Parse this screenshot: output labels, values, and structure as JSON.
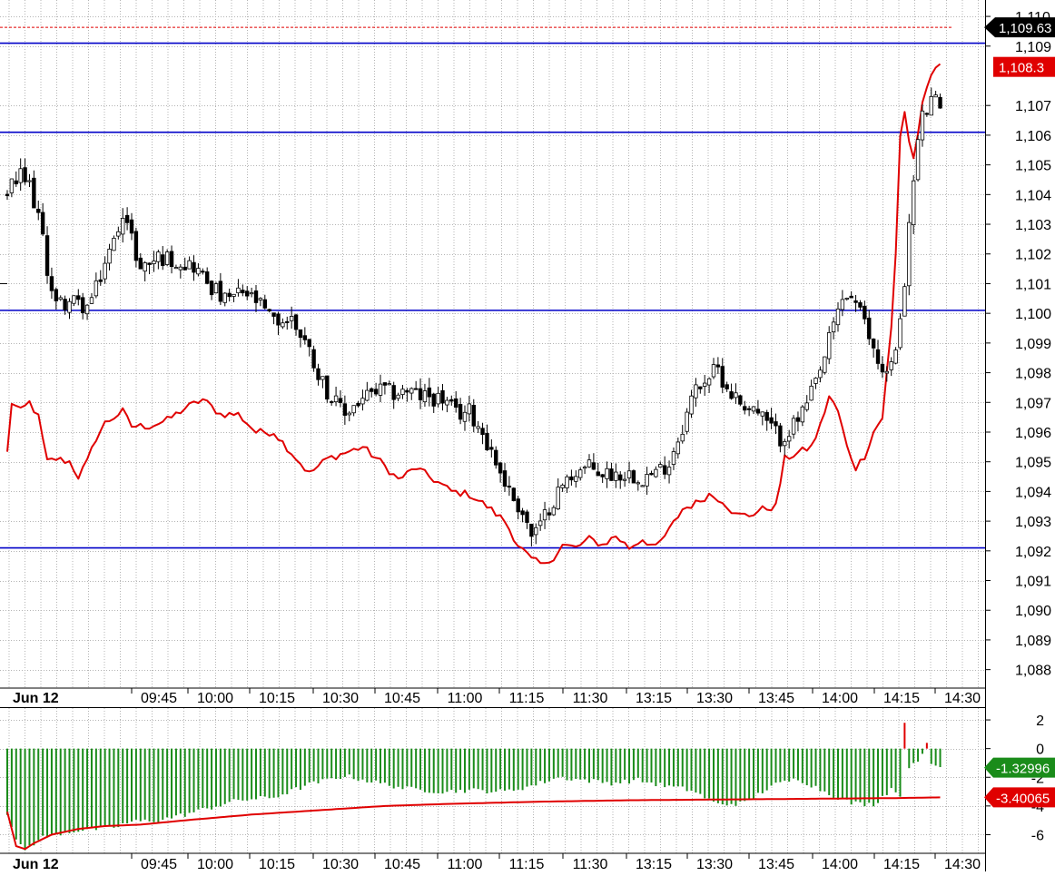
{
  "colors": {
    "background": "#ffffff",
    "grid": "#b4b4b4",
    "hline": "#0000c8",
    "price_line": "#e00000",
    "candle_up": "#ffffff",
    "candle_down": "#000000",
    "histogram": "#1a8c1a",
    "histogram_pos": "#e00000",
    "signal_line": "#e00000",
    "axis_text": "#000000",
    "tag_black": "#000000",
    "tag_red": "#e00000",
    "tag_green": "#1a8c1a"
  },
  "time_axis": {
    "date_label": "Jun 12",
    "labels": [
      "09:45",
      "10:00",
      "10:15",
      "10:30",
      "10:45",
      "11:00",
      "11:15",
      "11:30",
      "13:15",
      "13:30",
      "13:45",
      "14:00",
      "14:15",
      "14:30"
    ]
  },
  "main_chart": {
    "type": "candlestick",
    "grid": true,
    "ylim": [
      1.0875,
      1.1104
    ],
    "y_ticks": [
      "1,110",
      "1,109",
      "1,107",
      "1,106",
      "1,105",
      "1,104",
      "1,103",
      "1,102",
      "1,101",
      "1,100",
      "1,099",
      "1,098",
      "1,097",
      "1,096",
      "1,095",
      "1,094",
      "1,093",
      "1,092",
      "1,091",
      "1,090",
      "1,089",
      "1,088"
    ],
    "y_tick_values": [
      1.11,
      1.109,
      1.107,
      1.106,
      1.105,
      1.104,
      1.103,
      1.102,
      1.101,
      1.1,
      1.099,
      1.098,
      1.097,
      1.096,
      1.095,
      1.094,
      1.093,
      1.092,
      1.091,
      1.09,
      1.089,
      1.088
    ],
    "horizontal_lines": [
      1.1091,
      1.1061,
      1.1001,
      1.0921
    ],
    "dashed_line": 1.10963,
    "price_tags": [
      {
        "label": "1,109.63",
        "value": 1.10963,
        "style": "black"
      },
      {
        "label": "1,108.3",
        "value": 1.1083,
        "style": "red"
      }
    ],
    "candle_anchors": [
      [
        0,
        1.1041
      ],
      [
        3,
        1.1046
      ],
      [
        5,
        1.1043
      ],
      [
        7,
        1.1033
      ],
      [
        9,
        1.1015
      ],
      [
        11,
        1.1003
      ],
      [
        14,
        1.1004
      ],
      [
        18,
        1.1002
      ],
      [
        20,
        1.1008
      ],
      [
        22,
        1.1017
      ],
      [
        24,
        1.1024
      ],
      [
        26,
        1.1035
      ],
      [
        28,
        1.1025
      ],
      [
        30,
        1.1015
      ],
      [
        34,
        1.1019
      ],
      [
        38,
        1.1018
      ],
      [
        42,
        1.1016
      ],
      [
        46,
        1.1009
      ],
      [
        49,
        1.1004
      ],
      [
        53,
        1.1007
      ],
      [
        56,
        1.1004
      ],
      [
        60,
        1.0997
      ],
      [
        64,
        1.0998
      ],
      [
        67,
        1.0991
      ],
      [
        70,
        1.098
      ],
      [
        73,
        1.0971
      ],
      [
        76,
        1.0966
      ],
      [
        78,
        1.0969
      ],
      [
        81,
        1.0972
      ],
      [
        84,
        1.0974
      ],
      [
        87,
        1.0973
      ],
      [
        90,
        1.0974
      ],
      [
        93,
        1.0972
      ],
      [
        95,
        1.0972
      ],
      [
        98,
        1.0971
      ],
      [
        101,
        1.0966
      ],
      [
        104,
        1.0967
      ],
      [
        107,
        1.096
      ],
      [
        110,
        1.095
      ],
      [
        113,
        1.094
      ],
      [
        116,
        1.0933
      ],
      [
        118,
        1.0925
      ],
      [
        120,
        1.0928
      ],
      [
        122,
        1.0935
      ],
      [
        125,
        1.0942
      ],
      [
        128,
        1.0947
      ],
      [
        131,
        1.0948
      ],
      [
        134,
        1.0946
      ],
      [
        137,
        1.0946
      ],
      [
        140,
        1.0946
      ],
      [
        143,
        1.0945
      ],
      [
        146,
        1.0946
      ],
      [
        149,
        1.095
      ],
      [
        152,
        1.0962
      ],
      [
        155,
        1.0975
      ],
      [
        158,
        1.0979
      ],
      [
        160,
        1.0981
      ],
      [
        162,
        1.0975
      ],
      [
        165,
        1.097
      ],
      [
        168,
        1.0968
      ],
      [
        171,
        1.0963
      ],
      [
        174,
        1.0958
      ],
      [
        177,
        1.0962
      ],
      [
        180,
        1.0969
      ],
      [
        183,
        1.098
      ],
      [
        186,
        1.0996
      ],
      [
        188,
        1.1005
      ],
      [
        190,
        1.1006
      ],
      [
        192,
        1.1
      ],
      [
        194,
        1.0992
      ],
      [
        196,
        1.0984
      ],
      [
        198,
        1.098
      ],
      [
        200,
        1.0986
      ],
      [
        202,
        1.1012
      ],
      [
        204,
        1.1045
      ],
      [
        205,
        1.1058
      ],
      [
        206,
        1.1066
      ],
      [
        208,
        1.1071
      ],
      [
        209,
        1.1071
      ],
      [
        210,
        1.1069
      ]
    ],
    "red_line_anchors": [
      [
        0,
        1.0953
      ],
      [
        1,
        1.097
      ],
      [
        3,
        1.0967
      ],
      [
        5,
        1.097
      ],
      [
        7,
        1.0965
      ],
      [
        9,
        1.095
      ],
      [
        11,
        1.0951
      ],
      [
        14,
        1.095
      ],
      [
        16,
        1.0945
      ],
      [
        18,
        1.095
      ],
      [
        20,
        1.0958
      ],
      [
        22,
        1.0963
      ],
      [
        24,
        1.0965
      ],
      [
        26,
        1.0967
      ],
      [
        28,
        1.0962
      ],
      [
        32,
        1.0962
      ],
      [
        36,
        1.0964
      ],
      [
        40,
        1.0968
      ],
      [
        44,
        1.0971
      ],
      [
        48,
        1.0966
      ],
      [
        52,
        1.0966
      ],
      [
        56,
        1.096
      ],
      [
        60,
        1.096
      ],
      [
        64,
        1.0953
      ],
      [
        68,
        1.0946
      ],
      [
        72,
        1.0951
      ],
      [
        76,
        1.0953
      ],
      [
        80,
        1.0955
      ],
      [
        84,
        1.095
      ],
      [
        88,
        1.0944
      ],
      [
        92,
        1.0948
      ],
      [
        96,
        1.0944
      ],
      [
        100,
        1.094
      ],
      [
        104,
        1.0939
      ],
      [
        108,
        1.0935
      ],
      [
        112,
        1.093
      ],
      [
        115,
        1.0922
      ],
      [
        118,
        1.0917
      ],
      [
        121,
        1.0915
      ],
      [
        123,
        1.0918
      ],
      [
        125,
        1.0922
      ],
      [
        128,
        1.0921
      ],
      [
        131,
        1.0924
      ],
      [
        134,
        1.0922
      ],
      [
        137,
        1.0925
      ],
      [
        140,
        1.0921
      ],
      [
        143,
        1.0924
      ],
      [
        146,
        1.0921
      ],
      [
        149,
        1.0927
      ],
      [
        152,
        1.0934
      ],
      [
        155,
        1.0936
      ],
      [
        158,
        1.0939
      ],
      [
        161,
        1.0937
      ],
      [
        164,
        1.0932
      ],
      [
        167,
        1.0932
      ],
      [
        170,
        1.0934
      ],
      [
        173,
        1.0935
      ],
      [
        175,
        1.0951
      ],
      [
        178,
        1.0953
      ],
      [
        181,
        1.0955
      ],
      [
        183,
        1.0962
      ],
      [
        185,
        1.0972
      ],
      [
        187,
        1.0967
      ],
      [
        189,
        1.0955
      ],
      [
        191,
        1.0948
      ],
      [
        193,
        1.0952
      ],
      [
        195,
        1.096
      ],
      [
        197,
        1.0965
      ],
      [
        199,
        1.0995
      ],
      [
        200,
        1.102
      ],
      [
        201,
        1.106
      ],
      [
        202,
        1.1068
      ],
      [
        203,
        1.1058
      ],
      [
        204,
        1.1052
      ],
      [
        206,
        1.107
      ],
      [
        208,
        1.108
      ],
      [
        209,
        1.1083
      ],
      [
        210,
        1.1083
      ]
    ]
  },
  "indicator": {
    "type": "histogram",
    "ylim": [
      -7.3,
      2.7
    ],
    "y_ticks": [
      "2",
      "0",
      "-2",
      "-4",
      "-6"
    ],
    "y_tick_values": [
      2,
      0,
      -2,
      -4,
      -6
    ],
    "value_tags": [
      {
        "label": "-1.32996",
        "value": -1.33,
        "style": "green"
      },
      {
        "label": "-3.40065",
        "value": -3.4,
        "style": "red"
      }
    ],
    "hist_anchors": [
      [
        0,
        -4.5
      ],
      [
        2,
        -6.5
      ],
      [
        4,
        -7.0
      ],
      [
        8,
        -6.2
      ],
      [
        12,
        -5.9
      ],
      [
        16,
        -5.7
      ],
      [
        20,
        -5.6
      ],
      [
        24,
        -5.5
      ],
      [
        28,
        -5.1
      ],
      [
        34,
        -5.0
      ],
      [
        40,
        -4.6
      ],
      [
        46,
        -4.1
      ],
      [
        52,
        -3.6
      ],
      [
        60,
        -3.4
      ],
      [
        68,
        -2.5
      ],
      [
        76,
        -1.9
      ],
      [
        82,
        -2.3
      ],
      [
        90,
        -2.8
      ],
      [
        98,
        -3.0
      ],
      [
        104,
        -2.9
      ],
      [
        112,
        -3.0
      ],
      [
        118,
        -2.6
      ],
      [
        124,
        -2.0
      ],
      [
        130,
        -2.2
      ],
      [
        136,
        -2.4
      ],
      [
        142,
        -2.2
      ],
      [
        148,
        -2.6
      ],
      [
        154,
        -2.9
      ],
      [
        160,
        -3.9
      ],
      [
        166,
        -3.8
      ],
      [
        172,
        -2.6
      ],
      [
        178,
        -2.1
      ],
      [
        184,
        -3.0
      ],
      [
        190,
        -3.8
      ],
      [
        195,
        -3.9
      ],
      [
        199,
        -2.8
      ],
      [
        201,
        -3.2
      ],
      [
        202,
        1.8
      ],
      [
        203,
        -1.2
      ],
      [
        205,
        -0.8
      ],
      [
        207,
        0.4
      ],
      [
        208,
        -1.2
      ],
      [
        210,
        -1.3
      ]
    ],
    "signal_anchors": [
      [
        0,
        -4.4
      ],
      [
        2,
        -6.8
      ],
      [
        4,
        -7.0
      ],
      [
        6,
        -6.6
      ],
      [
        10,
        -6.0
      ],
      [
        16,
        -5.6
      ],
      [
        22,
        -5.4
      ],
      [
        30,
        -5.3
      ],
      [
        40,
        -5.0
      ],
      [
        55,
        -4.6
      ],
      [
        70,
        -4.3
      ],
      [
        85,
        -4.0
      ],
      [
        100,
        -3.85
      ],
      [
        120,
        -3.7
      ],
      [
        140,
        -3.6
      ],
      [
        160,
        -3.55
      ],
      [
        180,
        -3.5
      ],
      [
        200,
        -3.45
      ],
      [
        210,
        -3.4
      ]
    ]
  }
}
